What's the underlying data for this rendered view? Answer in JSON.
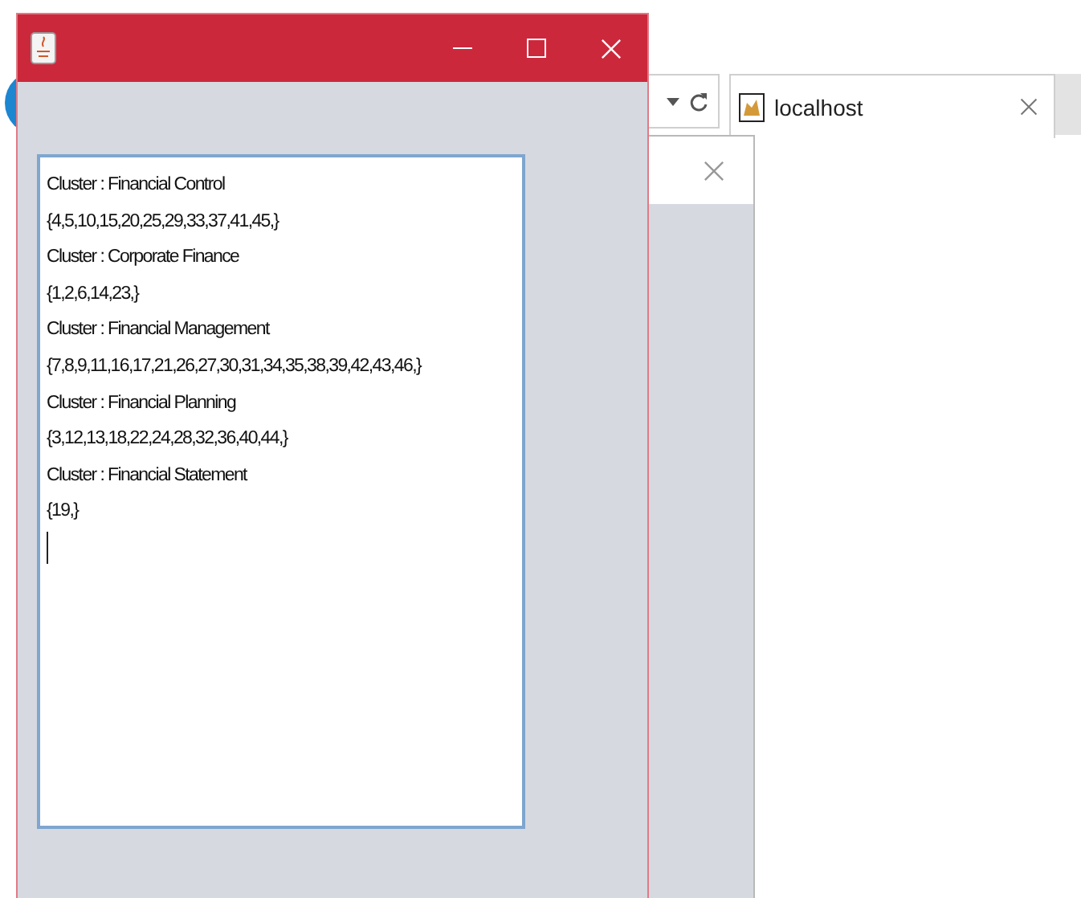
{
  "browser": {
    "tab": {
      "title": "localhost"
    }
  },
  "window": {
    "text_area": {
      "lines": [
        "Cluster : Financial Control",
        "{4,5,10,15,20,25,29,33,37,41,45,}",
        "Cluster : Corporate Finance",
        "{1,2,6,14,23,}",
        "Cluster : Financial Management",
        "{7,8,9,11,16,17,21,26,27,30,31,34,35,38,39,42,43,46,}",
        "Cluster : Financial Planning",
        "{3,12,13,18,22,24,28,32,36,40,44,}",
        "Cluster : Financial Statement",
        "{19,}"
      ]
    }
  }
}
